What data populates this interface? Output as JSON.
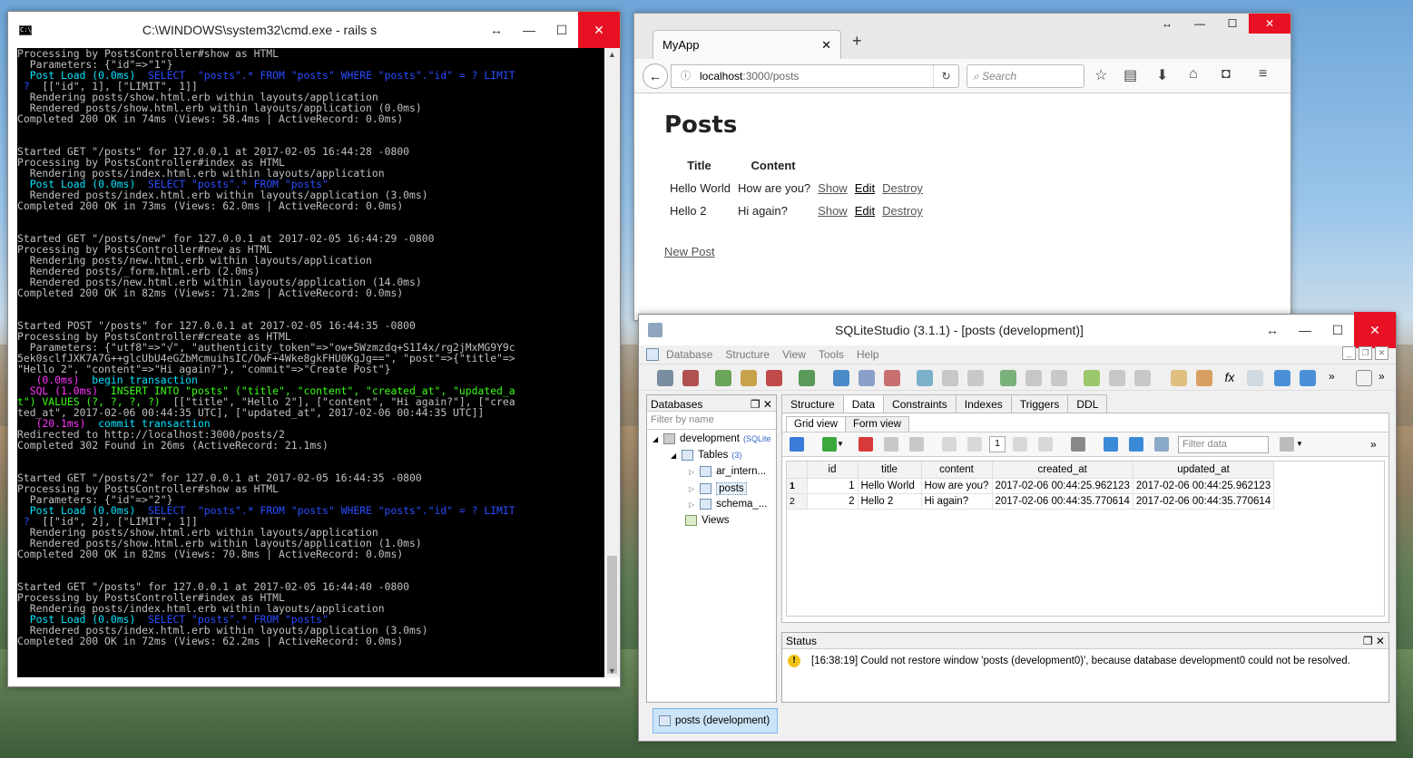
{
  "cmd": {
    "title": "C:\\WINDOWS\\system32\\cmd.exe - rails  s",
    "lines": [
      [
        {
          "t": "Processing by PostsController#show as HTML"
        }
      ],
      [
        {
          "t": "  Parameters: {\"id\"=>\"1\"}"
        }
      ],
      [
        {
          "t": "  "
        },
        {
          "t": "Post Load (0.0ms)",
          "c": "c-cy"
        },
        {
          "t": "  SELECT  \"posts\".* FROM \"posts\" WHERE \"posts\".\"id\" = ? LIMIT",
          "c": "c-bl"
        }
      ],
      [
        {
          "t": " ?",
          "c": "c-bl"
        },
        {
          "t": "  [[\"id\", 1], [\"LIMIT\", 1]]"
        }
      ],
      [
        {
          "t": "  Rendering posts/show.html.erb within layouts/application"
        }
      ],
      [
        {
          "t": "  Rendered posts/show.html.erb within layouts/application (0.0ms)"
        }
      ],
      [
        {
          "t": "Completed 200 OK in 74ms (Views: 58.4ms | ActiveRecord: 0.0ms)"
        }
      ],
      [
        {
          "t": ""
        }
      ],
      [
        {
          "t": ""
        }
      ],
      [
        {
          "t": "Started GET \"/posts\" for 127.0.0.1 at 2017-02-05 16:44:28 -0800"
        }
      ],
      [
        {
          "t": "Processing by PostsController#index as HTML"
        }
      ],
      [
        {
          "t": "  Rendering posts/index.html.erb within layouts/application"
        }
      ],
      [
        {
          "t": "  "
        },
        {
          "t": "Post Load (0.0ms)",
          "c": "c-cy"
        },
        {
          "t": "  SELECT \"posts\".* FROM \"posts\"",
          "c": "c-bl"
        }
      ],
      [
        {
          "t": "  Rendered posts/index.html.erb within layouts/application (3.0ms)"
        }
      ],
      [
        {
          "t": "Completed 200 OK in 73ms (Views: 62.0ms | ActiveRecord: 0.0ms)"
        }
      ],
      [
        {
          "t": ""
        }
      ],
      [
        {
          "t": ""
        }
      ],
      [
        {
          "t": "Started GET \"/posts/new\" for 127.0.0.1 at 2017-02-05 16:44:29 -0800"
        }
      ],
      [
        {
          "t": "Processing by PostsController#new as HTML"
        }
      ],
      [
        {
          "t": "  Rendering posts/new.html.erb within layouts/application"
        }
      ],
      [
        {
          "t": "  Rendered posts/_form.html.erb (2.0ms)"
        }
      ],
      [
        {
          "t": "  Rendered posts/new.html.erb within layouts/application (14.0ms)"
        }
      ],
      [
        {
          "t": "Completed 200 OK in 82ms (Views: 71.2ms | ActiveRecord: 0.0ms)"
        }
      ],
      [
        {
          "t": ""
        }
      ],
      [
        {
          "t": ""
        }
      ],
      [
        {
          "t": "Started POST \"/posts\" for 127.0.0.1 at 2017-02-05 16:44:35 -0800"
        }
      ],
      [
        {
          "t": "Processing by PostsController#create as HTML"
        }
      ],
      [
        {
          "t": "  Parameters: {\"utf8\"=>\"√\", \"authenticity_token\"=>\"ow+5Wzmzdq+S1I4x/rg2jMxMG9Y9c"
        }
      ],
      [
        {
          "t": "5ek0sclfJXK7A7G++glcUbU4eGZbMcmuihsIC/OwF+4Wke8gkFHU0KgJg==\", \"post\"=>{\"title\"=>"
        }
      ],
      [
        {
          "t": "\"Hello 2\", \"content\"=>\"Hi again?\"}, \"commit\"=>\"Create Post\"}"
        }
      ],
      [
        {
          "t": "   "
        },
        {
          "t": "(0.0ms)",
          "c": "c-mg"
        },
        {
          "t": "  begin transaction",
          "c": "c-cy"
        }
      ],
      [
        {
          "t": "  "
        },
        {
          "t": "SQL (1.0ms)",
          "c": "c-mg"
        },
        {
          "t": "  INSERT INTO \"posts\" (\"title\", \"content\", \"created_at\", \"updated_a",
          "c": "c-gr"
        }
      ],
      [
        {
          "t": "t\") VALUES (?, ?, ?, ?)",
          "c": "c-gr"
        },
        {
          "t": "  [[\"title\", \"Hello 2\"], [\"content\", \"Hi again?\"], [\"crea"
        }
      ],
      [
        {
          "t": "ted_at\", 2017-02-06 00:44:35 UTC], [\"updated_at\", 2017-02-06 00:44:35 UTC]]"
        }
      ],
      [
        {
          "t": "   "
        },
        {
          "t": "(20.1ms)",
          "c": "c-mg"
        },
        {
          "t": "  commit transaction",
          "c": "c-cy"
        }
      ],
      [
        {
          "t": "Redirected to http://localhost:3000/posts/2"
        }
      ],
      [
        {
          "t": "Completed 302 Found in 26ms (ActiveRecord: 21.1ms)"
        }
      ],
      [
        {
          "t": ""
        }
      ],
      [
        {
          "t": ""
        }
      ],
      [
        {
          "t": "Started GET \"/posts/2\" for 127.0.0.1 at 2017-02-05 16:44:35 -0800"
        }
      ],
      [
        {
          "t": "Processing by PostsController#show as HTML"
        }
      ],
      [
        {
          "t": "  Parameters: {\"id\"=>\"2\"}"
        }
      ],
      [
        {
          "t": "  "
        },
        {
          "t": "Post Load (0.0ms)",
          "c": "c-cy"
        },
        {
          "t": "  SELECT  \"posts\".* FROM \"posts\" WHERE \"posts\".\"id\" = ? LIMIT",
          "c": "c-bl"
        }
      ],
      [
        {
          "t": " ?",
          "c": "c-bl"
        },
        {
          "t": "  [[\"id\", 2], [\"LIMIT\", 1]]"
        }
      ],
      [
        {
          "t": "  Rendering posts/show.html.erb within layouts/application"
        }
      ],
      [
        {
          "t": "  Rendered posts/show.html.erb within layouts/application (1.0ms)"
        }
      ],
      [
        {
          "t": "Completed 200 OK in 82ms (Views: 70.8ms | ActiveRecord: 0.0ms)"
        }
      ],
      [
        {
          "t": ""
        }
      ],
      [
        {
          "t": ""
        }
      ],
      [
        {
          "t": "Started GET \"/posts\" for 127.0.0.1 at 2017-02-05 16:44:40 -0800"
        }
      ],
      [
        {
          "t": "Processing by PostsController#index as HTML"
        }
      ],
      [
        {
          "t": "  Rendering posts/index.html.erb within layouts/application"
        }
      ],
      [
        {
          "t": "  "
        },
        {
          "t": "Post Load (0.0ms)",
          "c": "c-cy"
        },
        {
          "t": "  SELECT \"posts\".* FROM \"posts\"",
          "c": "c-bl"
        }
      ],
      [
        {
          "t": "  Rendered posts/index.html.erb within layouts/application (3.0ms)"
        }
      ],
      [
        {
          "t": "Completed 200 OK in 72ms (Views: 62.2ms | ActiveRecord: 0.0ms)"
        }
      ]
    ]
  },
  "browser": {
    "tab_title": "MyApp",
    "url_host": "localhost",
    "url_path": ":3000/posts",
    "search_placeholder": "Search",
    "page": {
      "heading": "Posts",
      "columns": [
        "Title",
        "Content"
      ],
      "rows": [
        {
          "title": "Hello World",
          "content": "How are you?",
          "show": "Show",
          "edit": "Edit",
          "destroy": "Destroy"
        },
        {
          "title": "Hello 2",
          "content": "Hi again?",
          "show": "Show",
          "edit": "Edit",
          "destroy": "Destroy"
        }
      ],
      "new_link": "New Post"
    }
  },
  "sqlite": {
    "title": "SQLiteStudio (3.1.1) - [posts (development)]",
    "menu": [
      "Database",
      "Structure",
      "View",
      "Tools",
      "Help"
    ],
    "databases_panel": {
      "header": "Databases",
      "filter_placeholder": "Filter by name",
      "db_name": "development",
      "db_type": "(SQLite",
      "tables_label": "Tables",
      "tables_count": "(3)",
      "tables": [
        "ar_intern...",
        "posts",
        "schema_..."
      ],
      "views_label": "Views"
    },
    "tabs": [
      "Structure",
      "Data",
      "Constraints",
      "Indexes",
      "Triggers",
      "DDL"
    ],
    "subtabs": [
      "Grid view",
      "Form view"
    ],
    "page_number": "1",
    "filter_placeholder": "Filter data",
    "grid": {
      "columns": [
        "id",
        "title",
        "content",
        "created_at",
        "updated_at"
      ],
      "rows": [
        {
          "rn": "1",
          "id": "1",
          "title": "Hello World",
          "content": "How are you?",
          "created_at": "2017-02-06 00:44:25.962123",
          "updated_at": "2017-02-06 00:44:25.962123"
        },
        {
          "rn": "2",
          "id": "2",
          "title": "Hello 2",
          "content": "Hi again?",
          "created_at": "2017-02-06 00:44:35.770614",
          "updated_at": "2017-02-06 00:44:35.770614"
        }
      ]
    },
    "status": {
      "header": "Status",
      "message": "[16:38:19]  Could not restore window 'posts (development0)', because database development0 could not be resolved."
    },
    "task_label": "posts (development)"
  }
}
